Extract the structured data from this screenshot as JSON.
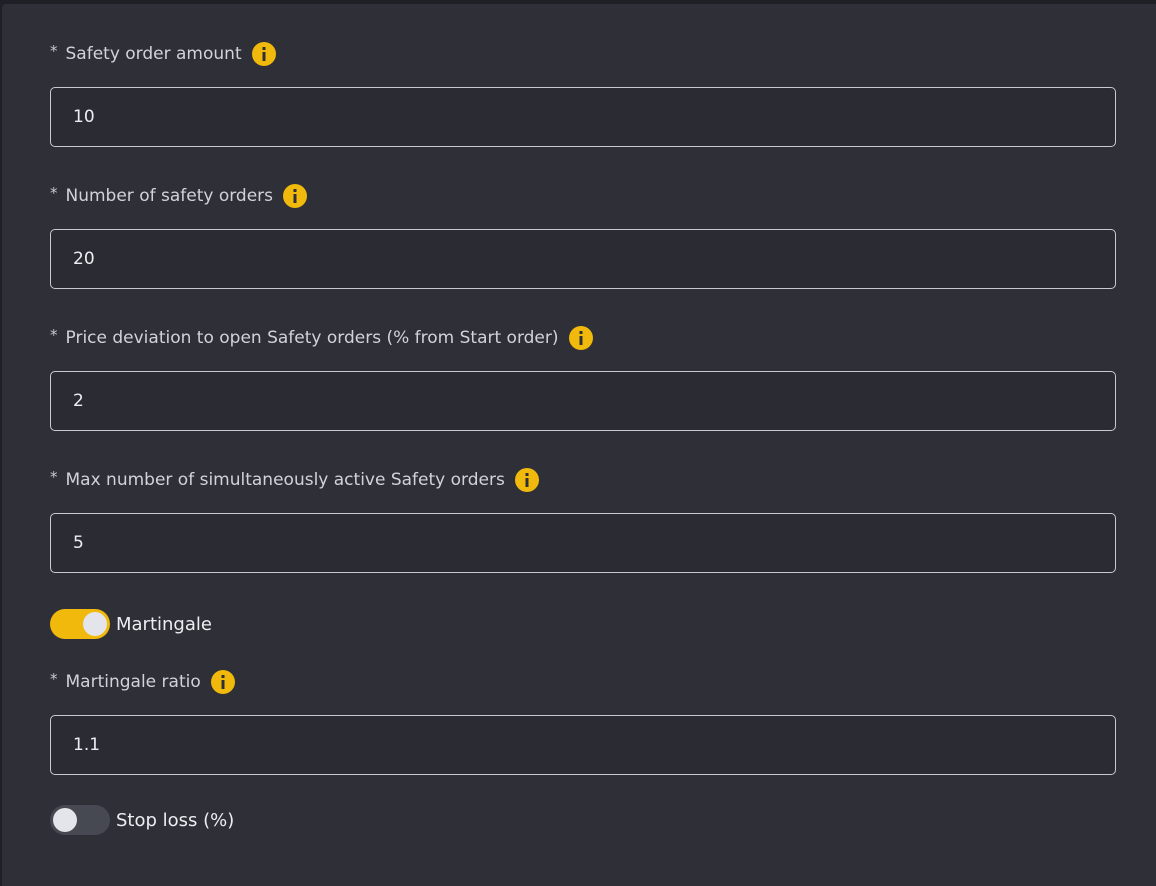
{
  "fields": [
    {
      "required_mark": "*",
      "label": "Safety order amount",
      "value": "10",
      "icon": "info-icon"
    },
    {
      "required_mark": "*",
      "label": "Number of safety orders",
      "value": "20",
      "icon": "info-icon"
    },
    {
      "required_mark": "*",
      "label": "Price deviation to open Safety orders (% from Start order)",
      "value": "2",
      "icon": "info-icon"
    },
    {
      "required_mark": "*",
      "label": "Max number of simultaneously active Safety orders",
      "value": "5",
      "icon": "info-icon"
    }
  ],
  "martingale": {
    "toggle_label": "Martingale",
    "enabled": true,
    "ratio_field": {
      "required_mark": "*",
      "label": "Martingale ratio",
      "value": "1.1",
      "icon": "info-icon"
    }
  },
  "stop_loss": {
    "toggle_label": "Stop loss (%)",
    "enabled": false
  },
  "colors": {
    "accent": "#f0b90b",
    "panel_bg": "#2e2f37",
    "input_border": "#c9cad0",
    "toggle_off": "#464852"
  }
}
